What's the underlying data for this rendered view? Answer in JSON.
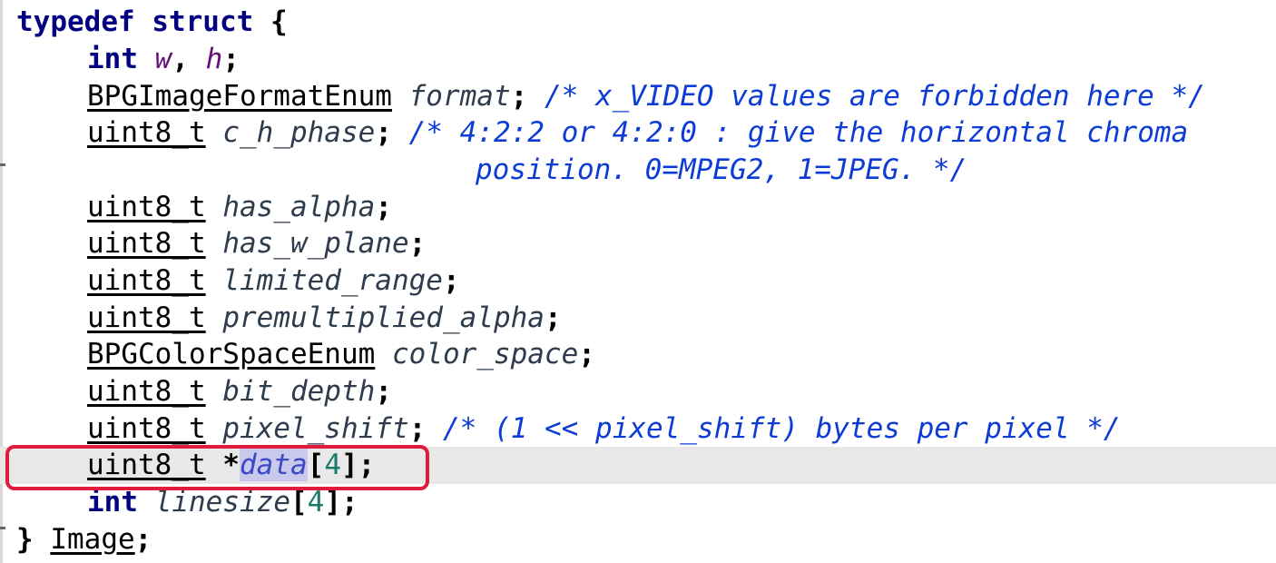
{
  "code": {
    "l0": {
      "kw": "typedef struct",
      "brace": " {"
    },
    "l1": {
      "kw": "int",
      "f1": "w",
      "sep": ", ",
      "f2": "h",
      "semi": ";"
    },
    "l2": {
      "type": "BPGImageFormatEnum",
      "field": "format",
      "semi": ";",
      "comment": "/* x_VIDEO values are forbidden here */"
    },
    "l3": {
      "type": "uint8_t",
      "field": "c_h_phase",
      "semi": ";",
      "comment": "/* 4:2:2 or 4:2:0 : give the horizontal chroma"
    },
    "l4": {
      "comment": "position. 0=MPEG2, 1=JPEG. */"
    },
    "l5": {
      "type": "uint8_t",
      "field": "has_alpha",
      "semi": ";"
    },
    "l6": {
      "type": "uint8_t",
      "field": "has_w_plane",
      "semi": ";"
    },
    "l7": {
      "type": "uint8_t",
      "field": "limited_range",
      "semi": ";"
    },
    "l8": {
      "type": "uint8_t",
      "field": "premultiplied_alpha",
      "semi": ";"
    },
    "l9": {
      "type": "BPGColorSpaceEnum",
      "field": "color_space",
      "semi": ";"
    },
    "l10": {
      "type": "uint8_t",
      "field": "bit_depth",
      "semi": ";"
    },
    "l11": {
      "type": "uint8_t",
      "field": "pixel_shift",
      "semi": ";",
      "comment": "/* (1 << pixel_shift) bytes per pixel */"
    },
    "l12": {
      "type": "uint8_t",
      "star": "*",
      "field": "data",
      "open": "[",
      "num": "4",
      "close": "];"
    },
    "l13": {
      "kw": "int",
      "field": "linesize",
      "open": "[",
      "num": "4",
      "close": "];"
    },
    "l14": {
      "brace": "}",
      "type": "Image",
      "semi": ";"
    }
  },
  "colors": {
    "keyword": "#000080",
    "comment": "#0d3bd6",
    "number": "#1a7a6b",
    "current_line": "#e8e8e8",
    "highlight_border": "#e21b3c"
  }
}
